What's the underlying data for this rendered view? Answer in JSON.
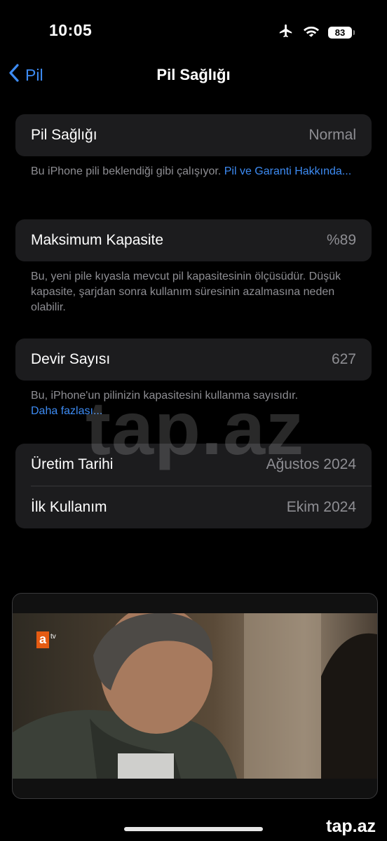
{
  "status_bar": {
    "time": "10:05",
    "battery_level": "83",
    "icons": [
      "airplane-icon",
      "wifi-icon",
      "battery-icon"
    ]
  },
  "nav": {
    "back_label": "Pil",
    "title": "Pil Sağlığı"
  },
  "battery_health": {
    "label": "Pil Sağlığı",
    "value": "Normal",
    "footer_text": "Bu iPhone pili beklendiği gibi çalışıyor. ",
    "footer_link": "Pil ve Garanti Hakkında..."
  },
  "max_capacity": {
    "label": "Maksimum Kapasite",
    "value": "%89",
    "footer_text": "Bu, yeni pile kıyasla mevcut pil kapasitesinin ölçüsüdür. Düşük kapasite, şarjdan sonra kullanım süresinin azalmasına neden olabilir."
  },
  "cycle_count": {
    "label": "Devir Sayısı",
    "value": "627",
    "footer_text": "Bu, iPhone'un pilinizin kapasitesini kullanma sayısıdır.",
    "footer_link": "Daha fazlası..."
  },
  "dates": {
    "manufacture_label": "Üretim Tarihi",
    "manufacture_value": "Ağustos 2024",
    "first_use_label": "İlk Kullanım",
    "first_use_value": "Ekim 2024"
  },
  "video": {
    "channel_logo": "a",
    "channel_suffix": "tv"
  },
  "watermark": "tap.az",
  "brand_logo": "tap.az",
  "colors": {
    "background": "#000000",
    "card": "#1c1c1e",
    "secondary_text": "#8e8e93",
    "link": "#3d8bf3"
  }
}
